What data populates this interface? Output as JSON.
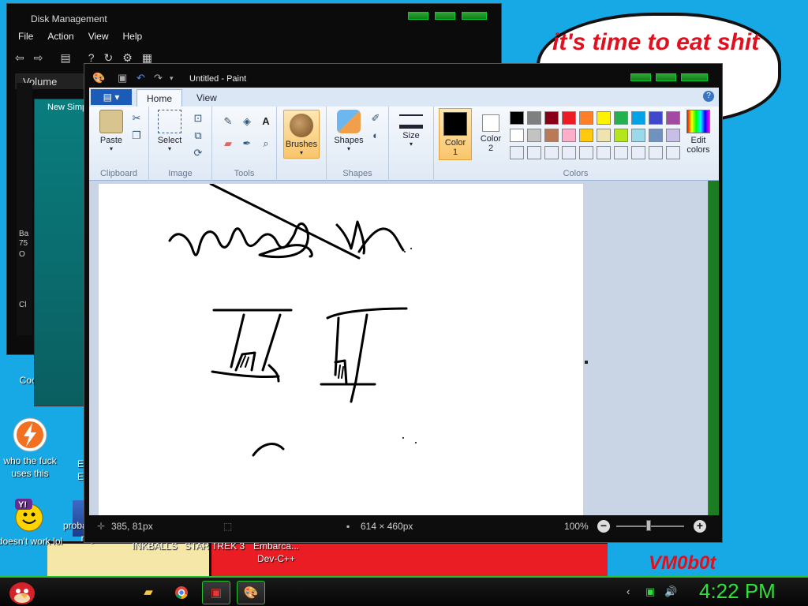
{
  "desktop": {
    "bubble_text": "it's time to eat shit\new",
    "signature": "VM0b0t",
    "icons": [
      {
        "label": "Cock",
        "name": "desktop-icon-cock"
      },
      {
        "label": "who the fuck uses this",
        "name": "desktop-icon-who-the-fuck"
      },
      {
        "label": "E\nE",
        "name": "desktop-icon-e"
      },
      {
        "label": "doesn't work lol",
        "name": "desktop-icon-doesnt-work"
      },
      {
        "label": "probably not a rogue",
        "name": "desktop-icon-probably-not-a-rogue"
      },
      {
        "label": "INKBALLS",
        "name": "desktop-icon-inkballs"
      },
      {
        "label": "STAR TREK 3",
        "name": "desktop-icon-star-trek-3"
      },
      {
        "label": "Embarca... Dev-C++",
        "name": "desktop-icon-dev-cpp"
      }
    ]
  },
  "disk_management": {
    "title": "Disk Management",
    "menu": [
      "File",
      "Action",
      "View",
      "Help"
    ],
    "column_header": "Volume",
    "new_simple": "New Simple",
    "left_snippets": [
      "Ba",
      "75",
      "O",
      "Cl"
    ]
  },
  "paint": {
    "title": "Untitled - Paint",
    "tabs": {
      "home": "Home",
      "view": "View"
    },
    "groups": {
      "clipboard": "Clipboard",
      "image": "Image",
      "tools": "Tools",
      "shapes": "Shapes",
      "colors": "Colors"
    },
    "buttons": {
      "paste": "Paste",
      "select": "Select",
      "brushes": "Brushes",
      "shapes": "Shapes",
      "size": "Size",
      "color1": "Color\n1",
      "color2": "Color\n2",
      "edit_colors": "Edit\ncolors"
    },
    "palette": [
      "#000000",
      "#7f7f7f",
      "#880015",
      "#ed1c24",
      "#ff7f27",
      "#fff200",
      "#22b14c",
      "#00a2e8",
      "#3f48cc",
      "#a349a4",
      "#ffffff",
      "#c3c3c3",
      "#b97a57",
      "#ffaec9",
      "#ffc90e",
      "#efe4b0",
      "#b5e61d",
      "#99d9ea",
      "#7092be",
      "#c8bfe7"
    ],
    "color1": "#000000",
    "color2": "#ffffff",
    "status": {
      "cursor": "385, 81px",
      "size": "614 × 460px",
      "zoom": "100%"
    }
  },
  "taskbar": {
    "clock": "4:22 PM"
  }
}
